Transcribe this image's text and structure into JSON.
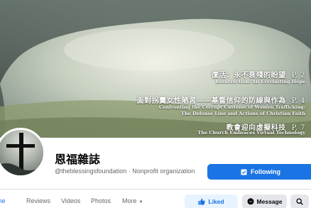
{
  "cover": {
    "title_zh": "復活：永不衰殘的盼望",
    "title_en": "Resurrection: An Everlasting Hope",
    "title_page": "P. 2",
    "article2_zh": "面對拐賣女性陋習——基督信仰的防線與作為",
    "article2_en_line1": "Confronting the Corrupt Customs of Women Trafficking:",
    "article2_en_line2": "The Defense Line and Actions of Christian Faith",
    "article2_page": "P. 4",
    "article3_zh": "教會迎向虛擬科技",
    "article3_en": "The Church Embraces Virtual Technology",
    "article3_page": "P. 7"
  },
  "profile": {
    "name": "恩福雜誌",
    "handle": "@theblessingsfoundation",
    "separator": "·",
    "category": "Nonprofit organization"
  },
  "actions": {
    "following_label": "Following",
    "liked_label": "Liked",
    "message_label": "Message"
  },
  "tabs": [
    {
      "label": "ome"
    },
    {
      "label": "Reviews"
    },
    {
      "label": "Videos"
    },
    {
      "label": "Photos"
    },
    {
      "label": "More"
    }
  ],
  "icons": {
    "following": "following-check-icon",
    "liked": "thumbs-up-icon",
    "message": "messenger-icon",
    "search": "search-icon",
    "more": "caret-down-icon"
  },
  "colors": {
    "accent": "#1b74e4",
    "liked_bg": "#e7f3ff",
    "secondary_bg": "#e4e6eb",
    "muted_text": "#65676b"
  }
}
